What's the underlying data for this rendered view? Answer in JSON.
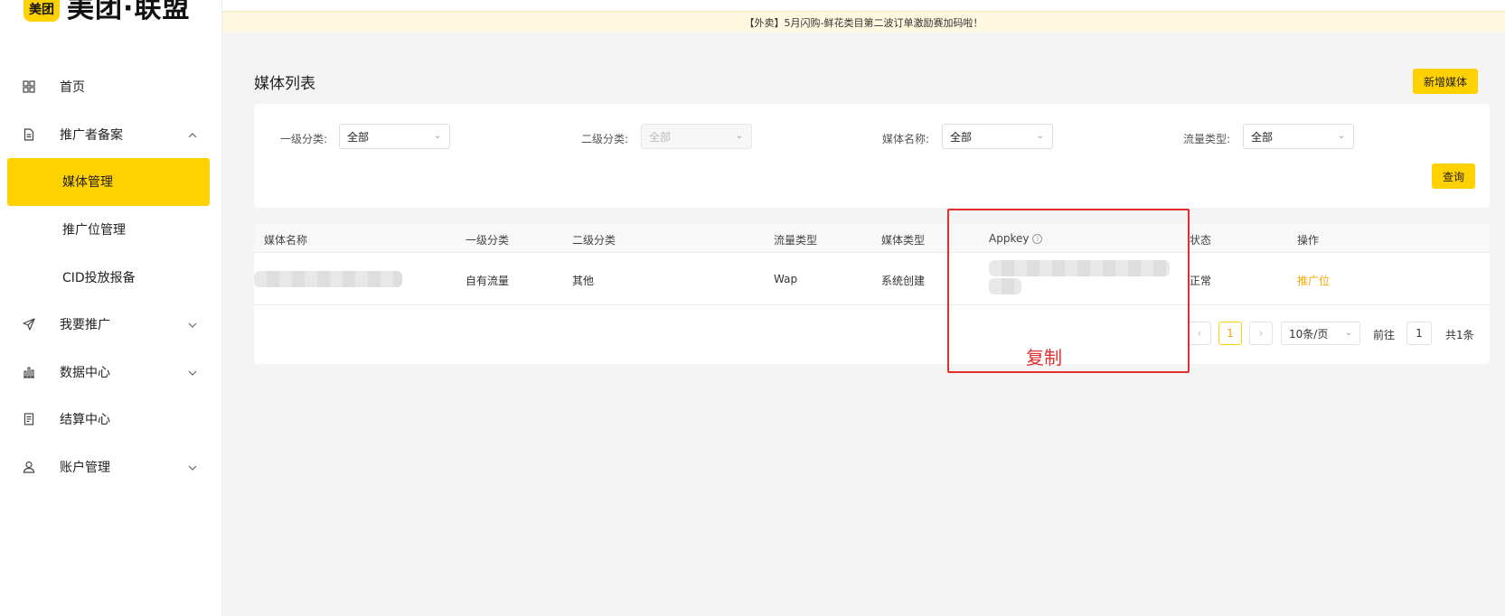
{
  "logo": {
    "mark": "美团",
    "text": "美团·联盟"
  },
  "banner": {
    "text": "【外卖】5月闪购-鲜花类目第二波订单激励赛加码啦！"
  },
  "menu": {
    "home": "首页",
    "filing": "推广者备案",
    "media_manage": "媒体管理",
    "slot_manage": "推广位管理",
    "cid_report": "CID投放报备",
    "promote": "我要推广",
    "data_center": "数据中心",
    "settle_center": "结算中心",
    "account_manage": "账户管理"
  },
  "page": {
    "title": "媒体列表",
    "add_button": "新增媒体"
  },
  "filters": {
    "level1_label": "一级分类:",
    "level1_value": "全部",
    "level2_label": "二级分类:",
    "level2_value": "全部",
    "media_name_label": "媒体名称:",
    "media_name_value": "全部",
    "traffic_type_label": "流量类型:",
    "traffic_type_value": "全部",
    "query_button": "查询"
  },
  "table": {
    "headers": {
      "media_name": "媒体名称",
      "level1": "一级分类",
      "level2": "二级分类",
      "traffic_type": "流量类型",
      "media_type": "媒体类型",
      "appkey": "Appkey",
      "status": "状态",
      "action": "操作"
    },
    "rows": [
      {
        "level1": "自有流量",
        "level2": "其他",
        "traffic_type": "Wap",
        "media_type": "系统创建",
        "status": "正常",
        "action": "推广位"
      }
    ]
  },
  "pagination": {
    "current": "1",
    "page_size": "10条/页",
    "goto_label": "前往",
    "goto_value": "1",
    "total": "共1条"
  },
  "annotation": {
    "text": "复制",
    "color": "#e52d2d"
  },
  "colors": {
    "accent": "#ffd100",
    "link": "#f5a600"
  }
}
